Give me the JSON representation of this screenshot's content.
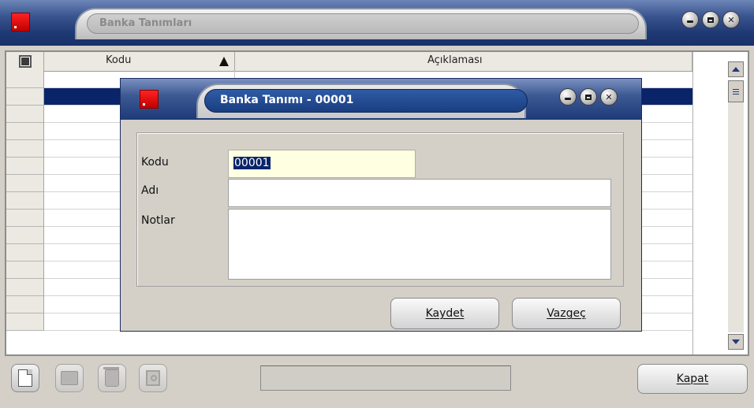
{
  "main_window": {
    "title": "Banka Tanımları",
    "controls": {
      "minimize": "minimize-icon",
      "maximize": "maximize-icon",
      "close": "close-icon"
    }
  },
  "grid": {
    "columns": [
      {
        "label": "Kodu",
        "sort": "ascending"
      },
      {
        "label": "Açıklaması"
      }
    ],
    "row_count": 15,
    "selected_row": 1
  },
  "dialog": {
    "title": "Banka Tanımı - 00001",
    "fields": {
      "kodu_label": "Kodu",
      "kodu_value": "00001",
      "adi_label": "Adı",
      "adi_value": "",
      "notlar_label": "Notlar",
      "notlar_value": ""
    },
    "buttons": {
      "save": "Kaydet",
      "cancel": "Vazgeç"
    }
  },
  "toolbar": {
    "icons": [
      "new-document-icon",
      "open-folder-icon",
      "delete-icon",
      "copy-icon"
    ],
    "status_text": "",
    "close_label": "Kapat"
  },
  "colors": {
    "selection": "#0a246a",
    "titlebar": "#1f3a75",
    "input_highlight": "#ffffe1",
    "app_icon": "#e00000"
  }
}
